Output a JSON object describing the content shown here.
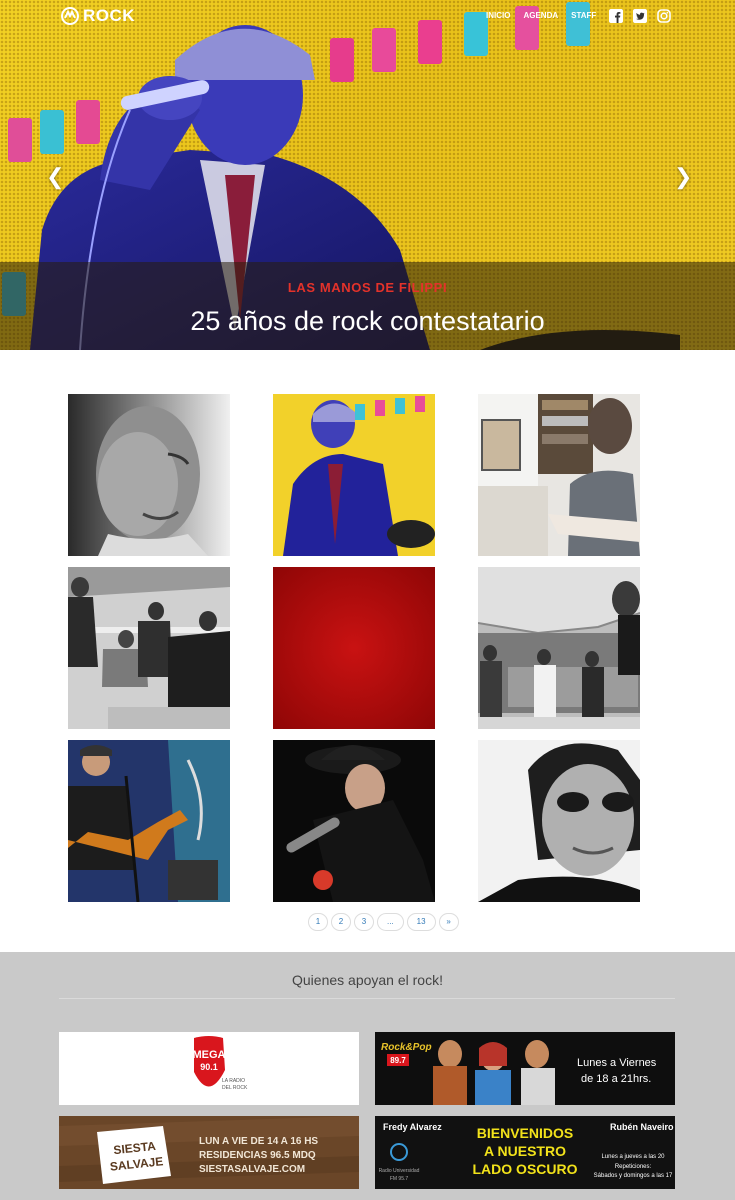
{
  "nav": {
    "logo_text": "ROCK",
    "links": [
      "INICIO",
      "AGENDA",
      "STAFF"
    ],
    "social": [
      "facebook-icon",
      "twitter-icon",
      "instagram-icon"
    ]
  },
  "hero": {
    "kicker": "LAS MANOS DE FILIPPI",
    "title": "25 años de rock contestatario",
    "prev_icon": "chevron-left-icon",
    "next_icon": "chevron-right-icon"
  },
  "gallery": {
    "tiles": [
      "bw-portrait-bald-man",
      "singer-blue-light-microphone",
      "guitarist-in-studio",
      "bw-band-on-rooftop",
      "red-placeholder",
      "bw-band-under-tent",
      "guitarist-on-stage",
      "singer-black-hat",
      "bw-man-sunglasses"
    ]
  },
  "pagination": {
    "pages": [
      "1",
      "2",
      "3",
      "...",
      "13",
      "»"
    ]
  },
  "sponsors": {
    "title": "Quienes apoyan el rock!",
    "banners": {
      "mega": {
        "logo": "MEGA",
        "freq": "90.1",
        "tagline_1": "LA RADIO",
        "tagline_2": "DEL ROCK"
      },
      "rock_pop": {
        "logo": "Rock&Pop",
        "freq": "89.7",
        "line_1": "Lunes a Viernes",
        "line_2": "de 18 a 21hrs."
      },
      "siesta": {
        "logo_1": "SIESTA",
        "logo_2": "SALVAJE",
        "line_1": "LUN A VIE DE 14 A 16 HS",
        "line_2": "RESIDENCIAS 96.5 MDQ",
        "line_3": "SIESTASALVAJE.COM"
      },
      "oscuro": {
        "host_1": "Fredy Alvarez",
        "host_2": "Rubén Naveiro",
        "title_1": "BIENVENIDOS",
        "title_2": "A NUESTRO",
        "title_3": "LADO OSCURO",
        "station_1": "Radio Universidad",
        "station_2": "FM 95.7",
        "sched_1": "Lunes a jueves a las 20",
        "sched_2": "Repeticiones:",
        "sched_3": "Sábados y domingos a las 17"
      }
    }
  }
}
